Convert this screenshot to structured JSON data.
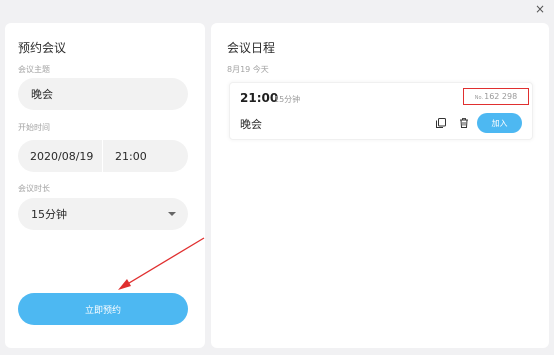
{
  "window": {
    "close_label": "×"
  },
  "left_panel": {
    "title": "预约会议",
    "topic_label": "会议主题",
    "topic_value": "晚会",
    "start_label": "开始时间",
    "start_date": "2020/08/19",
    "start_time": "21:00",
    "duration_label": "会议时长",
    "duration_value": "15分钟",
    "book_button": "立即预约"
  },
  "right_panel": {
    "title": "会议日程",
    "date_label": "8月19 今天",
    "meeting": {
      "time": "21:00",
      "duration": "15分钟",
      "number_prefix": "No.",
      "number": "162 298",
      "name": "晚会",
      "join_label": "加入"
    }
  },
  "colors": {
    "accent": "#4db8f2",
    "highlight": "#e02f2f",
    "background": "#f1f1f3"
  },
  "icons": [
    "close-icon",
    "copy-icon",
    "trash-icon",
    "chevron-down-icon"
  ]
}
